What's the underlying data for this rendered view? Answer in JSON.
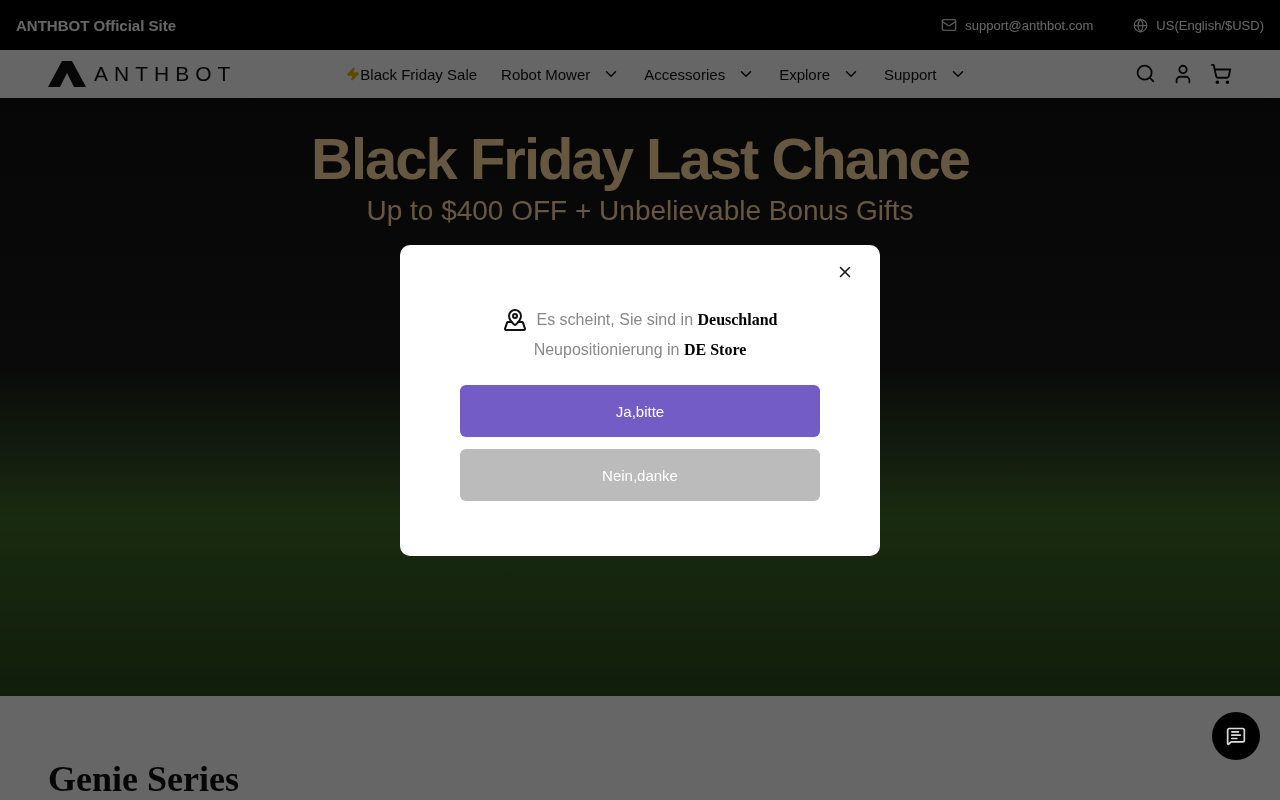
{
  "top_bar": {
    "site_label": "ANTHBOT Official Site",
    "email": "support@anthbot.com",
    "region": "US(English/$USD)"
  },
  "nav": {
    "logo": "ANTHBOT",
    "items": [
      {
        "label": "Black Friday Sale",
        "kind": "promo"
      },
      {
        "label": "Robot Mower",
        "kind": "dropdown"
      },
      {
        "label": "Accessories",
        "kind": "dropdown"
      },
      {
        "label": "Explore",
        "kind": "dropdown"
      },
      {
        "label": "Support",
        "kind": "dropdown"
      }
    ]
  },
  "hero": {
    "title": "Black Friday Last Chance",
    "subtitle": "Up to $400 OFF + Unbelievable Bonus Gifts"
  },
  "section": {
    "heading": "Genie Series"
  },
  "dialog": {
    "line1": "Es scheint, Sie sind in **Deuschland**",
    "line2": "Neupositionierung in **DE Store**",
    "buttons": [
      {
        "label": "Ja,bitte",
        "kind": "primary"
      },
      {
        "label": "Nein,danke",
        "kind": "secondary"
      }
    ]
  }
}
